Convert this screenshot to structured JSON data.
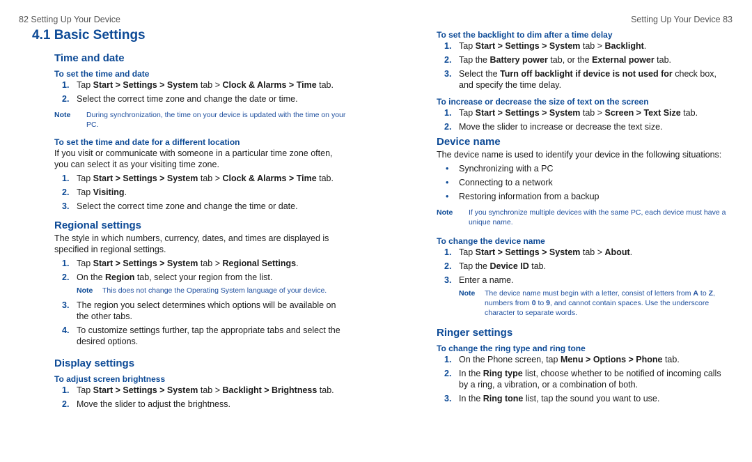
{
  "left_page": {
    "running_head": "82  Setting Up Your Device",
    "chapter_title": "4.1  Basic Settings",
    "time_and_date": {
      "heading": "Time and date",
      "proc1": {
        "title": "To set the time and date",
        "steps": [
          {
            "num": "1.",
            "parts": [
              "Tap ",
              "Start > Settings > System",
              " tab > ",
              "Clock & Alarms > Time",
              " tab."
            ]
          },
          {
            "num": "2.",
            "text": "Select the correct time zone and change the date or time."
          }
        ]
      },
      "note": {
        "label": "Note",
        "text": "During synchronization, the time on your device is updated with the time on your PC."
      },
      "proc2": {
        "title": "To set the time and date for a different location",
        "intro": "If you visit or communicate with someone in a particular time zone often, you can select it as your visiting time zone.",
        "steps": [
          {
            "num": "1.",
            "parts": [
              "Tap ",
              "Start > Settings > System",
              " tab > ",
              "Clock & Alarms > Time",
              " tab."
            ]
          },
          {
            "num": "2.",
            "parts": [
              "Tap ",
              "Visiting",
              "."
            ]
          },
          {
            "num": "3.",
            "text": "Select the correct time zone and change the time or date."
          }
        ]
      }
    },
    "regional": {
      "heading": "Regional settings",
      "intro": "The style in which numbers, currency, dates, and times are displayed is specified in regional settings.",
      "steps": [
        {
          "num": "1.",
          "parts": [
            "Tap ",
            "Start > Settings > System",
            " tab > ",
            "Regional Settings",
            "."
          ]
        },
        {
          "num": "2.",
          "parts": [
            "On the ",
            "Region",
            " tab, select your region from the list."
          ]
        },
        {
          "num": "3.",
          "text": "The region you select determines which options will be available on the other tabs."
        },
        {
          "num": "4.",
          "text": "To customize settings further, tap the appropriate tabs and select the desired options."
        }
      ],
      "note": {
        "label": "Note",
        "text": "This does not change the Operating System language of your device."
      }
    },
    "display": {
      "heading": "Display settings",
      "proc": {
        "title": "To adjust screen brightness",
        "steps": [
          {
            "num": "1.",
            "parts": [
              "Tap ",
              "Start > Settings > System",
              " tab > ",
              "Backlight > Brightness",
              " tab."
            ]
          },
          {
            "num": "2.",
            "text": "Move the slider to adjust the brightness."
          }
        ]
      }
    }
  },
  "right_page": {
    "running_head": "Setting Up Your Device  83",
    "backlight": {
      "title": "To set the backlight to dim after a time delay",
      "steps": [
        {
          "num": "1.",
          "parts": [
            "Tap ",
            "Start > Settings > System",
            " tab > ",
            "Backlight",
            "."
          ]
        },
        {
          "num": "2.",
          "parts": [
            "Tap the ",
            "Battery power",
            " tab, or the ",
            "External power",
            " tab."
          ]
        },
        {
          "num": "3.",
          "parts": [
            "Select the ",
            "Turn off backlight if device is not used for",
            " check box, and specify the time delay."
          ]
        }
      ]
    },
    "text_size": {
      "title": "To increase or decrease the size of text on the screen",
      "steps": [
        {
          "num": "1.",
          "parts": [
            "Tap ",
            "Start > Settings > System",
            " tab > ",
            "Screen > Text Size",
            " tab."
          ]
        },
        {
          "num": "2.",
          "text": "Move the slider to increase or decrease the text size."
        }
      ]
    },
    "device_name": {
      "heading": "Device name",
      "intro": "The device name is used to identify your device in the following situations:",
      "bullets": [
        "Synchronizing with a PC",
        "Connecting to a network",
        "Restoring information from a backup"
      ],
      "note": {
        "label": "Note",
        "text": "If you synchronize multiple devices with the same PC, each device must have a unique name."
      },
      "proc": {
        "title": "To change the device name",
        "steps": [
          {
            "num": "1.",
            "parts": [
              "Tap ",
              "Start > Settings > System",
              " tab > ",
              "About",
              "."
            ]
          },
          {
            "num": "2.",
            "parts": [
              "Tap the ",
              "Device ID",
              " tab."
            ]
          },
          {
            "num": "3.",
            "text": "Enter a name."
          }
        ],
        "note": {
          "label": "Note",
          "parts": [
            "The device name must begin with a letter, consist of letters from ",
            "A",
            " to ",
            "Z",
            ", numbers from ",
            "0",
            " to ",
            "9",
            ", and cannot contain spaces. Use the underscore character to separate words."
          ]
        }
      }
    },
    "ringer": {
      "heading": "Ringer settings",
      "proc": {
        "title": "To change the ring type and ring tone",
        "steps": [
          {
            "num": "1.",
            "parts": [
              "On the Phone screen, tap ",
              "Menu > Options > Phone",
              " tab."
            ]
          },
          {
            "num": "2.",
            "parts": [
              "In the ",
              "Ring type",
              " list, choose whether to be notified of incoming calls by a ring, a vibration, or a combination of both."
            ]
          },
          {
            "num": "3.",
            "parts": [
              "In the ",
              "Ring tone",
              " list, tap the sound you want to use."
            ]
          }
        ]
      }
    }
  },
  "colors": {
    "heading_blue": "#0d4a96",
    "note_blue": "#1f4f9e",
    "running_head_gray": "#555555"
  }
}
